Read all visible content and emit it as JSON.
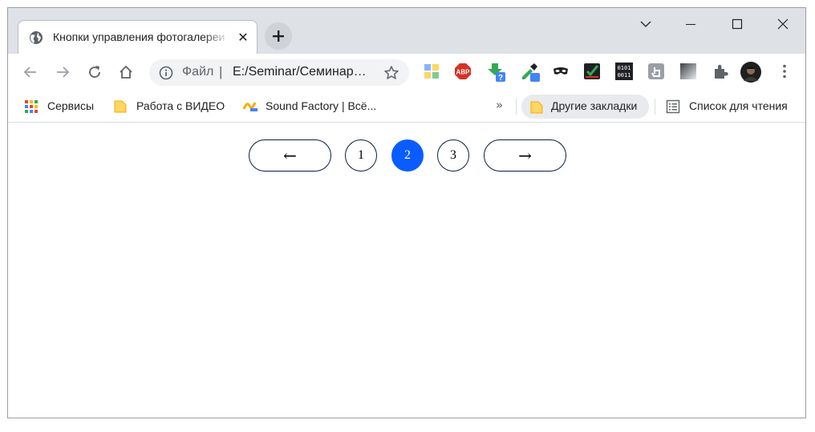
{
  "tab": {
    "title": "Кнопки управления фотогалереи",
    "close_glyph": "✕",
    "favicon": "globe-icon"
  },
  "window_controls": [
    "chevron-down-icon",
    "minimize-icon",
    "maximize-icon",
    "close-icon"
  ],
  "toolbar": {
    "back": "arrow-left-icon",
    "forward": "arrow-right-icon",
    "reload": "reload-icon",
    "home": "home-icon",
    "omnibox": {
      "scheme_label": "Файл",
      "separator": "|",
      "url": "E:/Seminar/Семинар…",
      "info_icon": "info-icon",
      "bookmark_icon": "star-icon"
    },
    "extensions": [
      "colorful-extension-icon",
      "adblock-icon",
      "download-helper-icon",
      "eyedropper-icon",
      "incognito-mask-icon",
      "checkmark-extension-icon",
      "binary-extension-icon",
      "touch-extension-icon",
      "gradient-extension-icon",
      "puzzle-icon",
      "avatar",
      "kebab-menu-icon"
    ],
    "abp_text": "ABP",
    "binary_text": [
      "0101",
      "0011"
    ]
  },
  "bookmarks": {
    "items": [
      {
        "label": "Сервисы",
        "icon": "apps-grid-icon"
      },
      {
        "label": "Работа с ВИДЕО",
        "icon": "folder-icon"
      },
      {
        "label": "Sound Factory | Всё...",
        "icon": "sound-factory-icon"
      }
    ],
    "overflow": "»",
    "other": {
      "label": "Другие закладки",
      "icon": "folder-icon"
    },
    "reading_list": {
      "label": "Список для чтения",
      "icon": "reading-list-icon"
    }
  },
  "pager": {
    "prev": "←",
    "next": "→",
    "pages": [
      "1",
      "2",
      "3"
    ],
    "active_page": "2"
  },
  "colors": {
    "accent": "#0a5cff",
    "tabstrip": "#dee1e6",
    "omnibox": "#f1f3f4",
    "pager_border": "#0a1f3d"
  }
}
